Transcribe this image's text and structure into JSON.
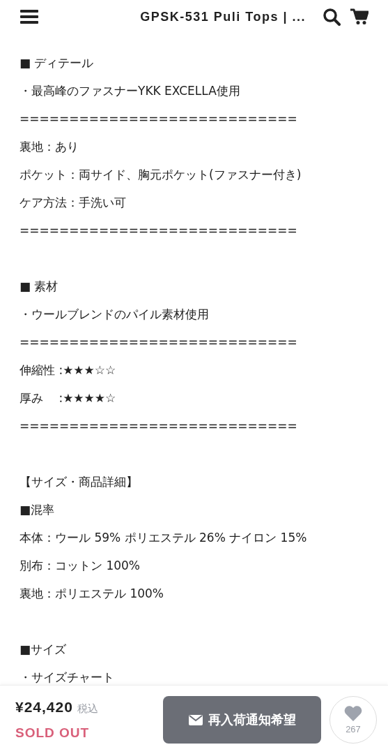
{
  "header": {
    "title": "GPSK-531 Puli Tops | ..."
  },
  "sections": [
    {
      "lines": [
        "■ ディテール",
        "・最高峰のファスナーYKK EXCELLA使用",
        "============================",
        "裏地：あり",
        "ポケット：両サイド、胸元ポケット(ファスナー付き)",
        "ケア方法：手洗い可",
        "============================"
      ]
    },
    {
      "lines": [
        "■ 素材",
        "・ウールブレンドのパイル素材使用",
        "============================",
        "伸縮性 :★★★☆☆",
        "厚み　 :★★★★☆",
        "============================"
      ]
    },
    {
      "lines": [
        "【サイズ・商品詳細】",
        "■混率",
        "本体：ウール 59% ポリエステル 26% ナイロン 15%",
        "別布：コットン 100%",
        "裏地：ポリエステル 100%"
      ]
    },
    {
      "lines": [
        "■サイズ",
        "・サイズチャート"
      ]
    }
  ],
  "footer": {
    "price": "¥24,420",
    "tax_note": "税込",
    "status": "SOLD OUT",
    "notify_button": "再入荷通知希望",
    "like_count": "267"
  }
}
